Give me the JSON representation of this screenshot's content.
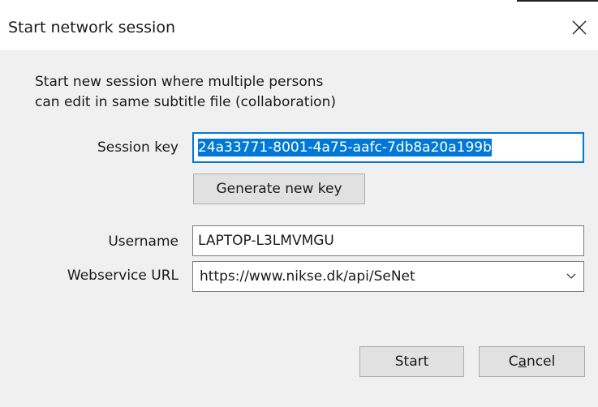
{
  "window": {
    "title": "Start network session",
    "close_icon": "close-icon"
  },
  "description": {
    "line1": "Start new session where multiple persons",
    "line2": "can edit in same subtitle file (collaboration)"
  },
  "session_key": {
    "label": "Session key",
    "value": "24a33771-8001-4a75-aafc-7db8a20a199b",
    "selected": true
  },
  "generate_button": {
    "label": "Generate new key"
  },
  "username": {
    "label": "Username",
    "value": "LAPTOP-L3LMVMGU"
  },
  "webservice": {
    "label": "Webservice URL",
    "value": "https://www.nikse.dk/api/SeNet",
    "dropdown_icon": "chevron-down-icon"
  },
  "actions": {
    "start_label": "Start",
    "cancel_label_prefix": "C",
    "cancel_label_mnemonic": "a",
    "cancel_label_suffix": "ncel"
  },
  "colors": {
    "selection": "#0078d7",
    "focus_border": "#0078d7",
    "client_bg": "#f0f0f0",
    "button_bg": "#e1e1e1"
  }
}
